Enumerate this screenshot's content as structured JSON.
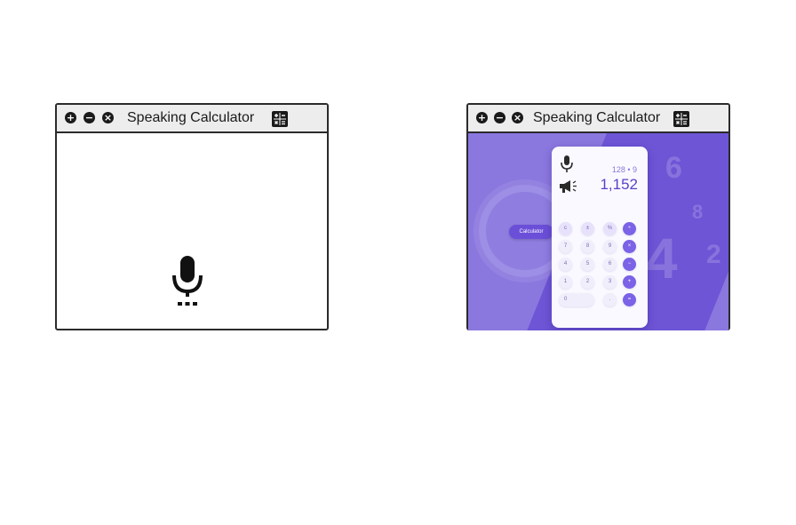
{
  "windows": [
    {
      "title": "Speaking Calculator",
      "controls": [
        "+",
        "−",
        "×"
      ]
    },
    {
      "title": "Speaking Calculator",
      "controls": [
        "+",
        "−",
        "×"
      ],
      "calculator": {
        "badge_label": "Calculator",
        "expression": "128 • 9",
        "result": "1,152",
        "keys": [
          "c",
          "±",
          "%",
          "÷",
          "7",
          "8",
          "9",
          "×",
          "4",
          "5",
          "6",
          "−",
          "1",
          "2",
          "3",
          "+",
          "0",
          ".",
          "="
        ],
        "deco_digits": [
          "6",
          "8",
          "4",
          "2"
        ]
      }
    }
  ],
  "colors": {
    "accent": "#7b62e6",
    "bg_purple": "#8b78df",
    "bg_dark_purple": "#6e55d6"
  },
  "icons": {
    "window_controls": [
      "plus-circle-icon",
      "minus-circle-icon",
      "close-circle-icon"
    ],
    "app": "calculator-icon",
    "listen": "microphone-icon",
    "speak": "megaphone-icon"
  }
}
